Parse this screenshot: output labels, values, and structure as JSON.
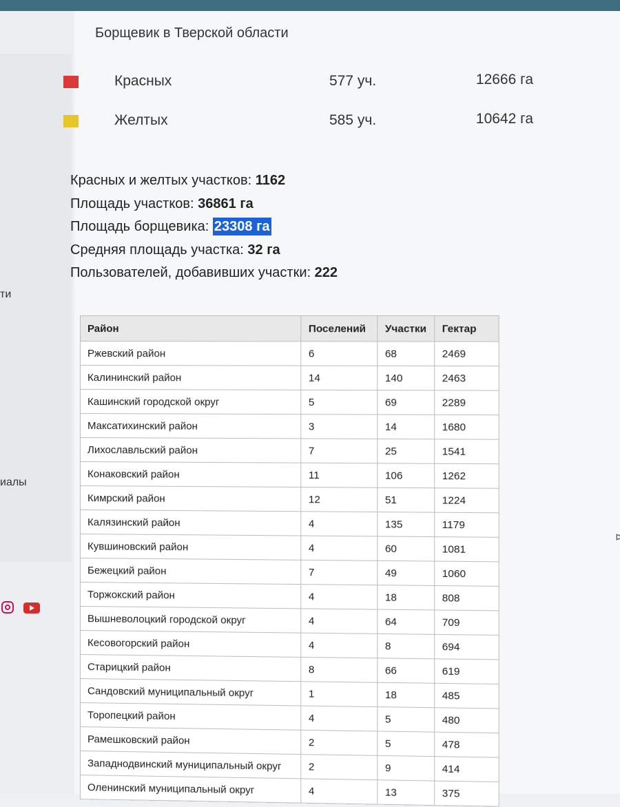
{
  "title": "Борщевик в Тверской области",
  "legend": [
    {
      "label": "Красных",
      "count": "577 уч.",
      "area": "12666 га",
      "color": "#d83a3a"
    },
    {
      "label": "Желтых",
      "count": "585 уч.",
      "area": "10642 га",
      "color": "#e6c52a"
    }
  ],
  "stats": {
    "plots_label": "Красных и желтых участков:",
    "plots_value": "1162",
    "area_label": "Площадь участков:",
    "area_value": "36861 га",
    "hogweed_label": "Площадь борщевика:",
    "hogweed_value": "23308 га",
    "avg_label": "Средняя площадь участка:",
    "avg_value": "32 га",
    "users_label": "Пользователей, добавивших участки:",
    "users_value": "222"
  },
  "left_nav": {
    "item1": "ти",
    "item2": "иалы"
  },
  "table": {
    "headers": [
      "Район",
      "Поселений",
      "Участки",
      "Гектар"
    ],
    "rows": [
      [
        "Ржевский район",
        "6",
        "68",
        "2469"
      ],
      [
        "Калининский район",
        "14",
        "140",
        "2463"
      ],
      [
        "Кашинский городской округ",
        "5",
        "69",
        "2289"
      ],
      [
        "Максатихинский район",
        "3",
        "14",
        "1680"
      ],
      [
        "Лихославльский район",
        "7",
        "25",
        "1541"
      ],
      [
        "Конаковский район",
        "11",
        "106",
        "1262"
      ],
      [
        "Кимрский район",
        "12",
        "51",
        "1224"
      ],
      [
        "Калязинский район",
        "4",
        "135",
        "1179"
      ],
      [
        "Кувшиновский район",
        "4",
        "60",
        "1081"
      ],
      [
        "Бежецкий район",
        "7",
        "49",
        "1060"
      ],
      [
        "Торжокский район",
        "4",
        "18",
        "808"
      ],
      [
        "Вышневолоцкий городской округ",
        "4",
        "64",
        "709"
      ],
      [
        "Кесовогорский район",
        "4",
        "8",
        "694"
      ],
      [
        "Старицкий район",
        "8",
        "66",
        "619"
      ],
      [
        "Сандовский муниципальный округ",
        "1",
        "18",
        "485"
      ],
      [
        "Торопецкий район",
        "4",
        "5",
        "480"
      ],
      [
        "Рамешковский район",
        "2",
        "5",
        "478"
      ],
      [
        "Западнодвинский муниципальный округ",
        "2",
        "9",
        "414"
      ],
      [
        "Оленинский муниципальный округ",
        "4",
        "13",
        "375"
      ]
    ]
  }
}
